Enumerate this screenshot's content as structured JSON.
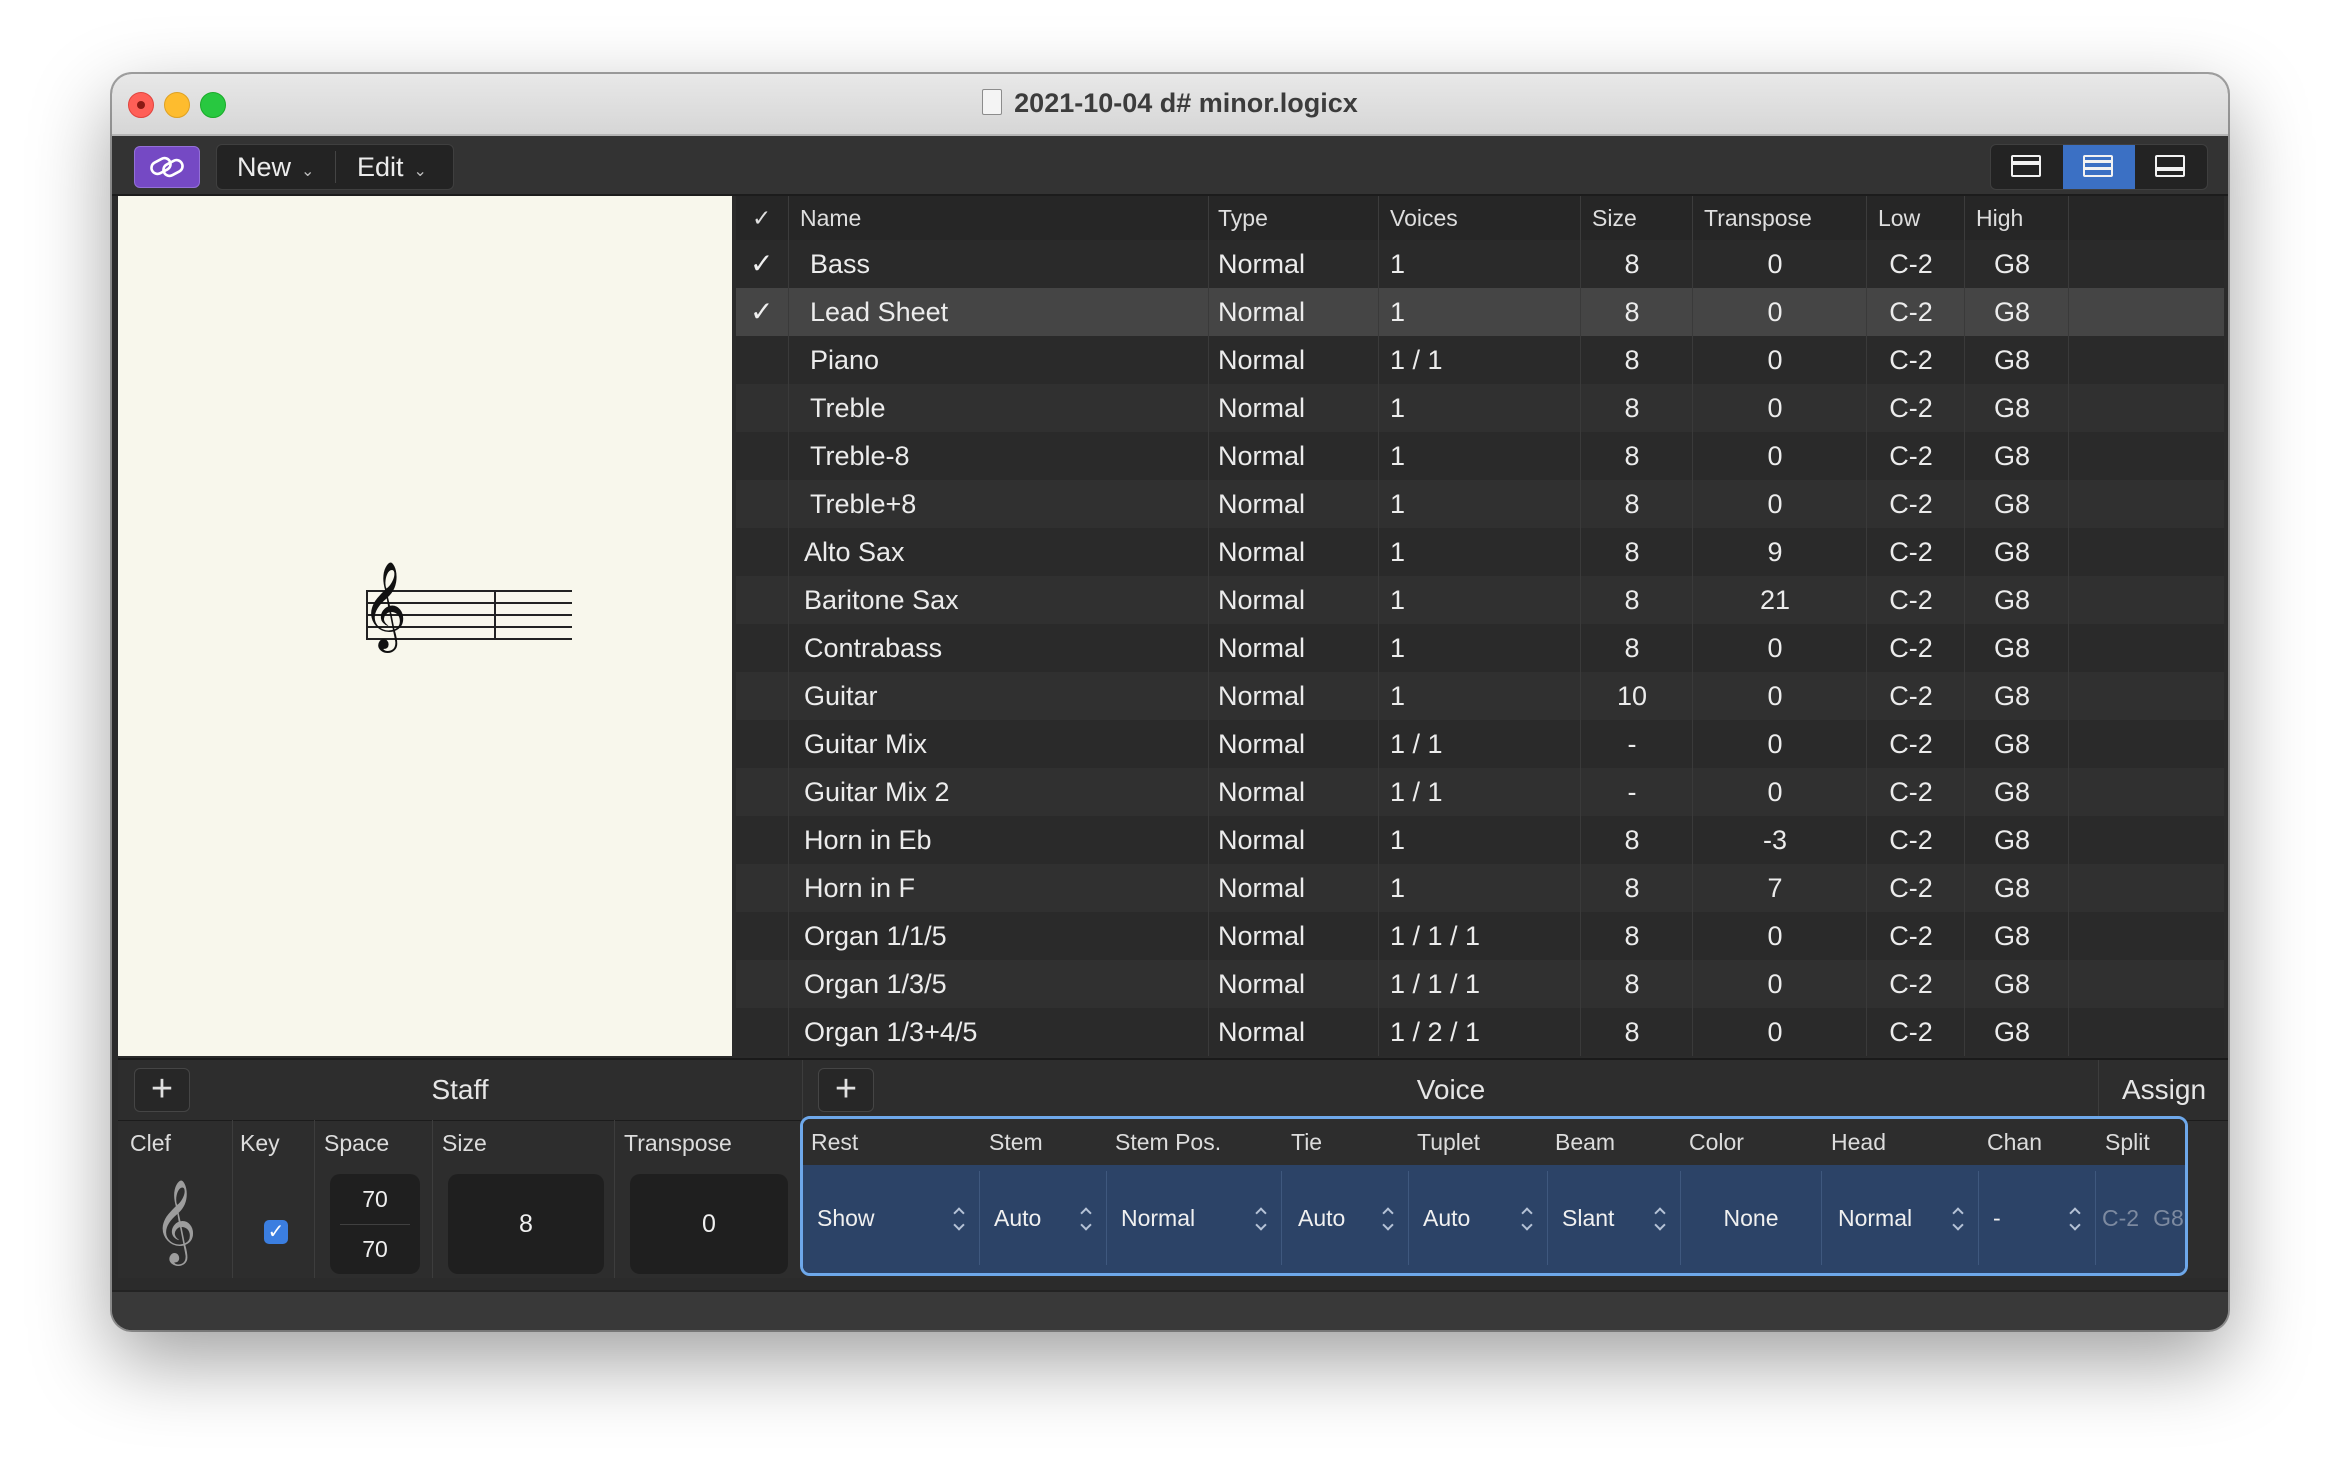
{
  "window": {
    "title": "2021-10-04 d# minor.logicx"
  },
  "toolbar": {
    "link_icon": "link-icon",
    "new_label": "New",
    "edit_label": "Edit",
    "view_icons": [
      "single-pane-icon",
      "list-pane-icon",
      "bottom-pane-icon"
    ],
    "active_view": 1,
    "accent_color": "#7549c4"
  },
  "preview": {
    "clef": "𝄞"
  },
  "list": {
    "headers": {
      "check": "✓",
      "name": "Name",
      "type": "Type",
      "voices": "Voices",
      "size": "Size",
      "transpose": "Transpose",
      "low": "Low",
      "high": "High"
    },
    "rows": [
      {
        "checked": "✓",
        "name": "Bass",
        "indent": true,
        "type": "Normal",
        "voices": "1",
        "size": "8",
        "transpose": "0",
        "low": "C-2",
        "high": "G8"
      },
      {
        "checked": "✓",
        "name": "Lead Sheet",
        "indent": true,
        "type": "Normal",
        "voices": "1",
        "size": "8",
        "transpose": "0",
        "low": "C-2",
        "high": "G8",
        "selected": true
      },
      {
        "checked": "",
        "name": "Piano",
        "indent": true,
        "type": "Normal",
        "voices": "1 / 1",
        "size": "8",
        "transpose": "0",
        "low": "C-2",
        "high": "G8"
      },
      {
        "checked": "",
        "name": "Treble",
        "indent": true,
        "type": "Normal",
        "voices": "1",
        "size": "8",
        "transpose": "0",
        "low": "C-2",
        "high": "G8"
      },
      {
        "checked": "",
        "name": "Treble-8",
        "indent": true,
        "type": "Normal",
        "voices": "1",
        "size": "8",
        "transpose": "0",
        "low": "C-2",
        "high": "G8"
      },
      {
        "checked": "",
        "name": "Treble+8",
        "indent": true,
        "type": "Normal",
        "voices": "1",
        "size": "8",
        "transpose": "0",
        "low": "C-2",
        "high": "G8"
      },
      {
        "checked": "",
        "name": "Alto Sax",
        "indent": false,
        "type": "Normal",
        "voices": "1",
        "size": "8",
        "transpose": "9",
        "low": "C-2",
        "high": "G8"
      },
      {
        "checked": "",
        "name": "Baritone Sax",
        "indent": false,
        "type": "Normal",
        "voices": "1",
        "size": "8",
        "transpose": "21",
        "low": "C-2",
        "high": "G8"
      },
      {
        "checked": "",
        "name": "Contrabass",
        "indent": false,
        "type": "Normal",
        "voices": "1",
        "size": "8",
        "transpose": "0",
        "low": "C-2",
        "high": "G8"
      },
      {
        "checked": "",
        "name": "Guitar",
        "indent": false,
        "type": "Normal",
        "voices": "1",
        "size": "10",
        "transpose": "0",
        "low": "C-2",
        "high": "G8"
      },
      {
        "checked": "",
        "name": "Guitar Mix",
        "indent": false,
        "type": "Normal",
        "voices": "1 / 1",
        "size": "-",
        "transpose": "0",
        "low": "C-2",
        "high": "G8"
      },
      {
        "checked": "",
        "name": "Guitar Mix 2",
        "indent": false,
        "type": "Normal",
        "voices": "1 / 1",
        "size": "-",
        "transpose": "0",
        "low": "C-2",
        "high": "G8"
      },
      {
        "checked": "",
        "name": "Horn in Eb",
        "indent": false,
        "type": "Normal",
        "voices": "1",
        "size": "8",
        "transpose": "-3",
        "low": "C-2",
        "high": "G8"
      },
      {
        "checked": "",
        "name": "Horn in F",
        "indent": false,
        "type": "Normal",
        "voices": "1",
        "size": "8",
        "transpose": "7",
        "low": "C-2",
        "high": "G8"
      },
      {
        "checked": "",
        "name": "Organ 1/1/5",
        "indent": false,
        "type": "Normal",
        "voices": "1 / 1 / 1",
        "size": "8",
        "transpose": "0",
        "low": "C-2",
        "high": "G8"
      },
      {
        "checked": "",
        "name": "Organ 1/3/5",
        "indent": false,
        "type": "Normal",
        "voices": "1 / 1 / 1",
        "size": "8",
        "transpose": "0",
        "low": "C-2",
        "high": "G8"
      },
      {
        "checked": "",
        "name": "Organ 1/3+4/5",
        "indent": false,
        "type": "Normal",
        "voices": "1 / 2 / 1",
        "size": "8",
        "transpose": "0",
        "low": "C-2",
        "high": "G8"
      }
    ]
  },
  "staff_panel": {
    "plus": "+",
    "title": "Staff",
    "labels": {
      "clef": "Clef",
      "key": "Key",
      "space": "Space",
      "size": "Size",
      "transpose": "Transpose"
    },
    "clef_glyph": "𝄞",
    "key_checked": "✓",
    "space_top": "70",
    "space_bottom": "70",
    "size": "8",
    "transpose": "0"
  },
  "voice_panel": {
    "plus": "+",
    "title": "Voice",
    "assign_title": "Assign",
    "labels": {
      "rest": "Rest",
      "stem": "Stem",
      "stem_pos": "Stem Pos.",
      "tie": "Tie",
      "tuplet": "Tuplet",
      "beam": "Beam",
      "color": "Color",
      "head": "Head",
      "chan": "Chan",
      "split": "Split"
    },
    "values": {
      "rest": "Show",
      "stem": "Auto",
      "stem_pos": "Normal",
      "tie": "Auto",
      "tuplet": "Auto",
      "beam": "Slant",
      "color": "None",
      "head": "Normal",
      "chan": "-",
      "split_low": "C-2",
      "split_high": "G8"
    },
    "highlight_color": "#6ea8ea"
  }
}
